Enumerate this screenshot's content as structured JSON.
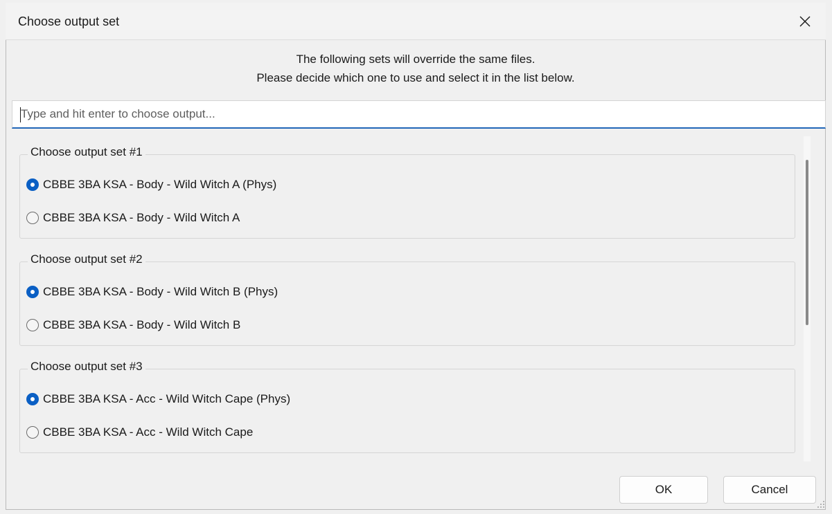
{
  "window": {
    "title": "Choose output set"
  },
  "instructions": {
    "line1": "The following sets will override the same files.",
    "line2": "Please decide which one to use and select it in the list below."
  },
  "search": {
    "placeholder": "Type and hit enter to choose output...",
    "value": ""
  },
  "groups": [
    {
      "label": "Choose output set #1",
      "options": [
        {
          "label": "CBBE 3BA KSA - Body - Wild Witch A (Phys)",
          "selected": true
        },
        {
          "label": "CBBE 3BA KSA - Body - Wild Witch A",
          "selected": false
        }
      ]
    },
    {
      "label": "Choose output set #2",
      "options": [
        {
          "label": "CBBE 3BA KSA - Body - Wild Witch B (Phys)",
          "selected": true
        },
        {
          "label": "CBBE 3BA KSA - Body - Wild Witch B",
          "selected": false
        }
      ]
    },
    {
      "label": "Choose output set #3",
      "options": [
        {
          "label": "CBBE 3BA KSA - Acc - Wild Witch Cape (Phys)",
          "selected": true
        },
        {
          "label": "CBBE 3BA KSA - Acc - Wild Witch Cape",
          "selected": false
        }
      ]
    }
  ],
  "buttons": {
    "ok": "OK",
    "cancel": "Cancel"
  },
  "icons": {
    "close": "close-icon",
    "resize": "resize-grip-icon"
  },
  "colors": {
    "accent": "#0a5fc4",
    "input_underline": "#2166b8",
    "background": "#f0f0f0"
  }
}
